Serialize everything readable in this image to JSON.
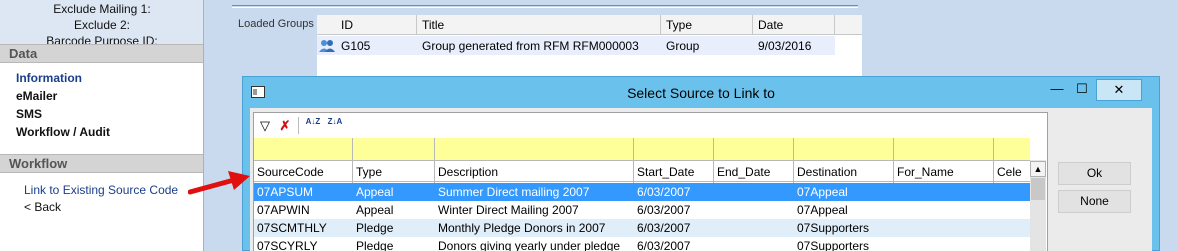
{
  "sidebar": {
    "top_fields": [
      "Exclude Mailing 1:",
      "Exclude 2:",
      "Barcode Purpose ID:"
    ],
    "data_section": "Data",
    "data_links": [
      "Information",
      "eMailer",
      "SMS",
      "Workflow / Audit"
    ],
    "workflow_section": "Workflow",
    "workflow_link": "Link to Existing Source Code",
    "back_link": "< Back"
  },
  "loaded_groups": {
    "label": "Loaded Groups",
    "columns": [
      "ID",
      "Title",
      "Type",
      "Date"
    ],
    "rows": [
      {
        "id": "G105",
        "title": "Group generated from RFM RFM000003",
        "type": "Group",
        "date": "9/03/2016"
      }
    ]
  },
  "dialog": {
    "title": "Select Source to Link to",
    "controls": {
      "minimize": "—",
      "maximize": "☐",
      "close": "✕"
    },
    "toolbar": {
      "filter": "▽",
      "clear_filter": "✗",
      "sort_asc": "A↓Z",
      "sort_desc": "Z↓A"
    },
    "columns": [
      "SourceCode",
      "Type",
      "Description",
      "Start_Date",
      "End_Date",
      "Destination",
      "For_Name",
      "Cele"
    ],
    "rows": [
      {
        "code": "07APSUM",
        "type": "Appeal",
        "description": "Summer Direct mailing 2007",
        "start": "6/03/2007",
        "end": "",
        "destination": "07Appeal",
        "for_name": ""
      },
      {
        "code": "07APWIN",
        "type": "Appeal",
        "description": "Winter Direct Mailing 2007",
        "start": "6/03/2007",
        "end": "",
        "destination": "07Appeal",
        "for_name": ""
      },
      {
        "code": "07SCMTHLY",
        "type": "Pledge",
        "description": "Monthly Pledge Donors in 2007",
        "start": "6/03/2007",
        "end": "",
        "destination": "07Supporters",
        "for_name": ""
      },
      {
        "code": "07SCYRLY",
        "type": "Pledge",
        "description": "Donors giving yearly under pledge",
        "start": "6/03/2007",
        "end": "",
        "destination": "07Supporters",
        "for_name": ""
      }
    ],
    "ok_label": "Ok",
    "none_label": "None"
  },
  "colors": {
    "selected_row": "#3399ff",
    "dialog_frame": "#6ac2ec",
    "filter_row": "#ffff99",
    "arrow": "#e01010"
  }
}
